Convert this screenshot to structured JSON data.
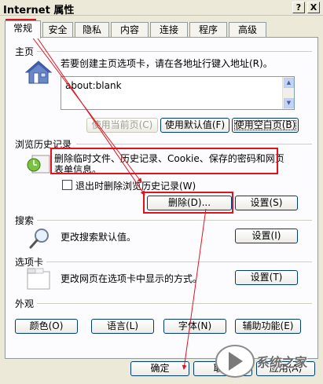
{
  "window": {
    "title": "Internet 属性",
    "help_button": "?",
    "close_button": "X"
  },
  "tabs": [
    {
      "label": "常规",
      "active": true
    },
    {
      "label": "安全"
    },
    {
      "label": "隐私"
    },
    {
      "label": "内容"
    },
    {
      "label": "连接"
    },
    {
      "label": "程序"
    },
    {
      "label": "高级"
    }
  ],
  "home": {
    "label": "主页",
    "instruction": "若要创建主页选项卡，请在各地址行键入地址(R)。",
    "address": "about:blank",
    "use_current_btn": "使用当前页(C)",
    "use_default_btn": "使用默认值(F)",
    "use_blank_btn": "使用空白页(B)",
    "icon": "house-icon"
  },
  "history": {
    "label": "浏览历史记录",
    "desc_line1": "删除临时文件、历史记录、Cookie、保存的密码和网页",
    "desc_line2": "表单信息。",
    "exit_delete_label": "退出时删除浏览历史记录(W)",
    "exit_delete_checked": false,
    "delete_btn": "删除(D)...",
    "settings_btn": "设置(S)",
    "icon": "history-clock-icon"
  },
  "search": {
    "label": "搜索",
    "desc": "更改搜索默认值。",
    "settings_btn": "设置(I)",
    "icon": "magnifier-icon"
  },
  "tabs_section": {
    "label": "选项卡",
    "desc": "更改网页在选项卡中显示的方式。",
    "settings_btn": "设置(T)",
    "icon": "tab-window-icon"
  },
  "appearance": {
    "label": "外观",
    "colors_btn": "颜色(O)",
    "languages_btn": "语言(L)",
    "fonts_btn": "字体(N)",
    "accessibility_btn": "辅助功能(E)"
  },
  "footer": {
    "ok_btn": "确定",
    "cancel_btn": "取消",
    "apply_btn": "应用(A)"
  },
  "watermark": {
    "text": "系统之家"
  },
  "colors": {
    "highlight": "#e0141e",
    "dialog_bg": "#ece9d8",
    "panel_bg": "#fcfcfe"
  }
}
